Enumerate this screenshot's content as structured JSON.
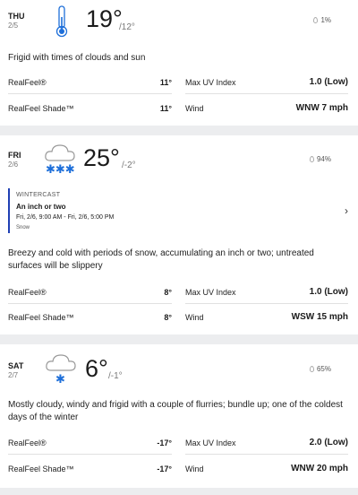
{
  "days": [
    {
      "day": "THU",
      "date": "2/5",
      "hi": "19°",
      "lo": "/12°",
      "precip": "1%",
      "icon": "thermometer-icon",
      "phrase": "Frigid with times of clouds and sun",
      "realfeel_label": "RealFeel®",
      "realfeel": "11°",
      "realfeel_shade_label": "RealFeel Shade™",
      "realfeel_shade": "11°",
      "uv_label": "Max UV Index",
      "uv": "1.0 (Low)",
      "wind_label": "Wind",
      "wind": "WNW 7 mph"
    },
    {
      "day": "FRI",
      "date": "2/6",
      "hi": "25°",
      "lo": "/-2°",
      "precip": "94%",
      "icon": "snow-cloud-icon",
      "wintercast": {
        "label": "WINTERCAST",
        "title": "An inch or two",
        "range": "Fri, 2/6, 9:00 AM - Fri, 2/6, 5:00 PM",
        "type": "Snow"
      },
      "phrase": "Breezy and cold with periods of snow, accumulating an inch or two; untreated surfaces will be slippery",
      "realfeel_label": "RealFeel®",
      "realfeel": "8°",
      "realfeel_shade_label": "RealFeel Shade™",
      "realfeel_shade": "8°",
      "uv_label": "Max UV Index",
      "uv": "1.0 (Low)",
      "wind_label": "Wind",
      "wind": "WSW 15 mph"
    },
    {
      "day": "SAT",
      "date": "2/7",
      "hi": "6°",
      "lo": "/-1°",
      "precip": "65%",
      "icon": "flurry-cloud-icon",
      "phrase": "Mostly cloudy, windy and frigid with a couple of flurries; bundle up; one of the coldest days of the winter",
      "realfeel_label": "RealFeel®",
      "realfeel": "-17°",
      "realfeel_shade_label": "RealFeel Shade™",
      "realfeel_shade": "-17°",
      "uv_label": "Max UV Index",
      "uv": "2.0 (Low)",
      "wind_label": "Wind",
      "wind": "WNW 20 mph"
    }
  ],
  "colors": {
    "snow": "#1e6fd9",
    "accent": "#1f3fb4",
    "background": "#ecedef"
  }
}
